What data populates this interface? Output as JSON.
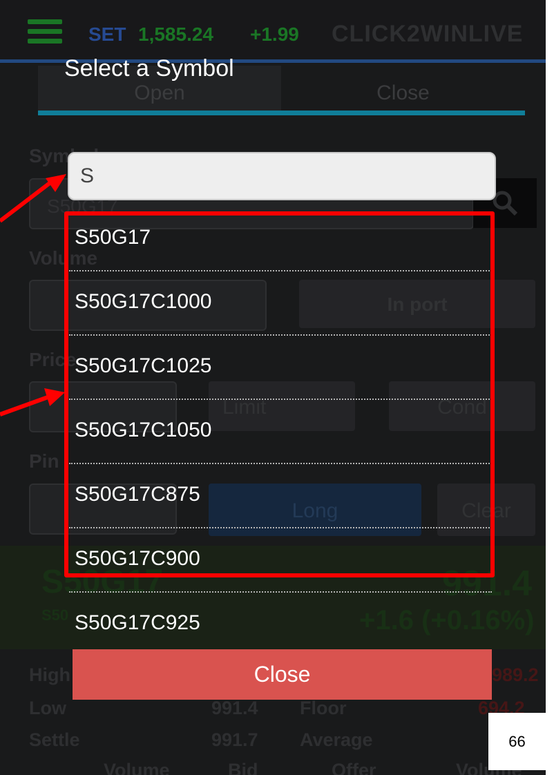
{
  "header": {
    "market": "SET",
    "index_value": "1,585.24",
    "index_change": "+1.99",
    "logo": "CLICK2WINLIVE",
    "menu_icon": "hamburger-menu-icon"
  },
  "tabs": [
    {
      "label": "Open"
    },
    {
      "label": "Close"
    }
  ],
  "form": {
    "symbol_label": "Symbol",
    "symbol_value": "S50G17",
    "volume_label": "Volume",
    "in_port_label": "In port",
    "price_label": "Price",
    "order_type": "Limit",
    "condition_label": "Cond",
    "pin_label": "Pin",
    "long_button": "Long",
    "clear_button": "Clear"
  },
  "quote": {
    "symbol": "S50G17",
    "symbol_sub": "S50",
    "price": "991.4",
    "change": "+1.6 (+0.16%)"
  },
  "stats": {
    "high_label": "High",
    "high_right_value": "989.2",
    "low_label": "Low",
    "low_value": "991.4",
    "floor_label": "Floor",
    "floor_value": "694.2",
    "settle_label": "Settle",
    "settle_value": "991.7",
    "average_label": "Average"
  },
  "table_headers": [
    "Volume",
    "Bid",
    "Offer",
    "Volume"
  ],
  "dialog": {
    "title": "Select a Symbol",
    "search_value": "S",
    "symbols": [
      "S50G17",
      "S50G17C1000",
      "S50G17C1025",
      "S50G17C1050",
      "S50G17C875",
      "S50G17C900",
      "S50G17C925"
    ],
    "close_label": "Close"
  },
  "page_number": "66",
  "colors": {
    "accent_tab": "#12a5c8",
    "close_button": "#d9534f",
    "annotation_red": "#ff0000"
  }
}
